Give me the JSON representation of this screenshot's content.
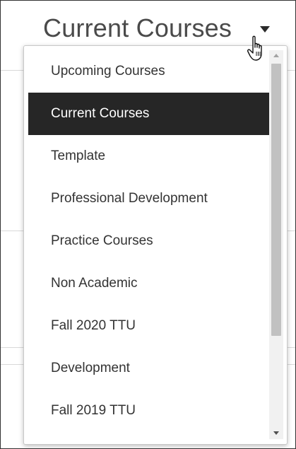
{
  "header": {
    "title": "Current Courses",
    "caret_icon": "caret-down-icon",
    "cursor_icon": "hand-pointer-icon"
  },
  "dropdown": {
    "selected": "Current Courses",
    "items": [
      {
        "label": "Upcoming Courses"
      },
      {
        "label": "Current Courses"
      },
      {
        "label": "Template"
      },
      {
        "label": "Professional Development"
      },
      {
        "label": "Practice Courses"
      },
      {
        "label": "Non Academic"
      },
      {
        "label": "Fall 2020 TTU"
      },
      {
        "label": "Development"
      },
      {
        "label": "Fall 2019 TTU"
      }
    ]
  },
  "colors": {
    "selected_bg": "#262626",
    "selected_text": "#ffffff",
    "item_text": "#333333",
    "title_text": "#4a4a4a"
  }
}
